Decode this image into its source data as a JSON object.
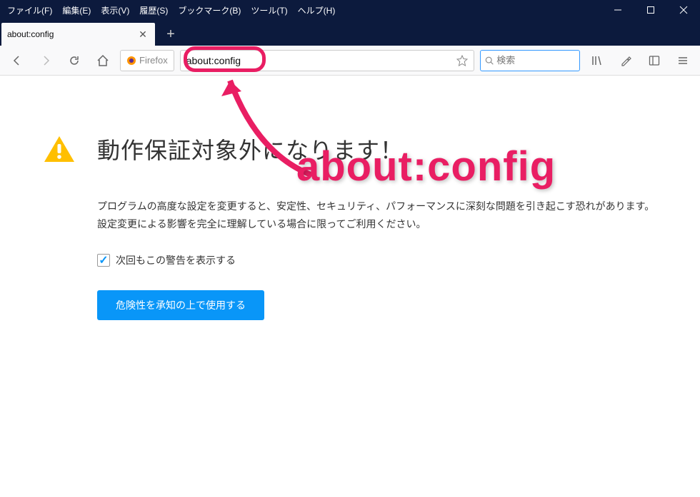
{
  "menubar": {
    "file": "ファイル(F)",
    "edit": "編集(E)",
    "view": "表示(V)",
    "history": "履歴(S)",
    "bookmarks": "ブックマーク(B)",
    "tools": "ツール(T)",
    "help": "ヘルプ(H)"
  },
  "tab": {
    "title": "about:config"
  },
  "navbar": {
    "identity": "Firefox",
    "url": "about:config",
    "search_placeholder": "検索"
  },
  "warning": {
    "title": "動作保証対象外になります！",
    "body": "プログラムの高度な設定を変更すると、安定性、セキュリティ、パフォーマンスに深刻な問題を引き起こす恐れがあります。設定変更による影響を完全に理解している場合に限ってご利用ください。",
    "checkbox_label": "次回もこの警告を表示する",
    "accept_button": "危険性を承知の上で使用する"
  },
  "annotation": {
    "label": "about:config"
  }
}
